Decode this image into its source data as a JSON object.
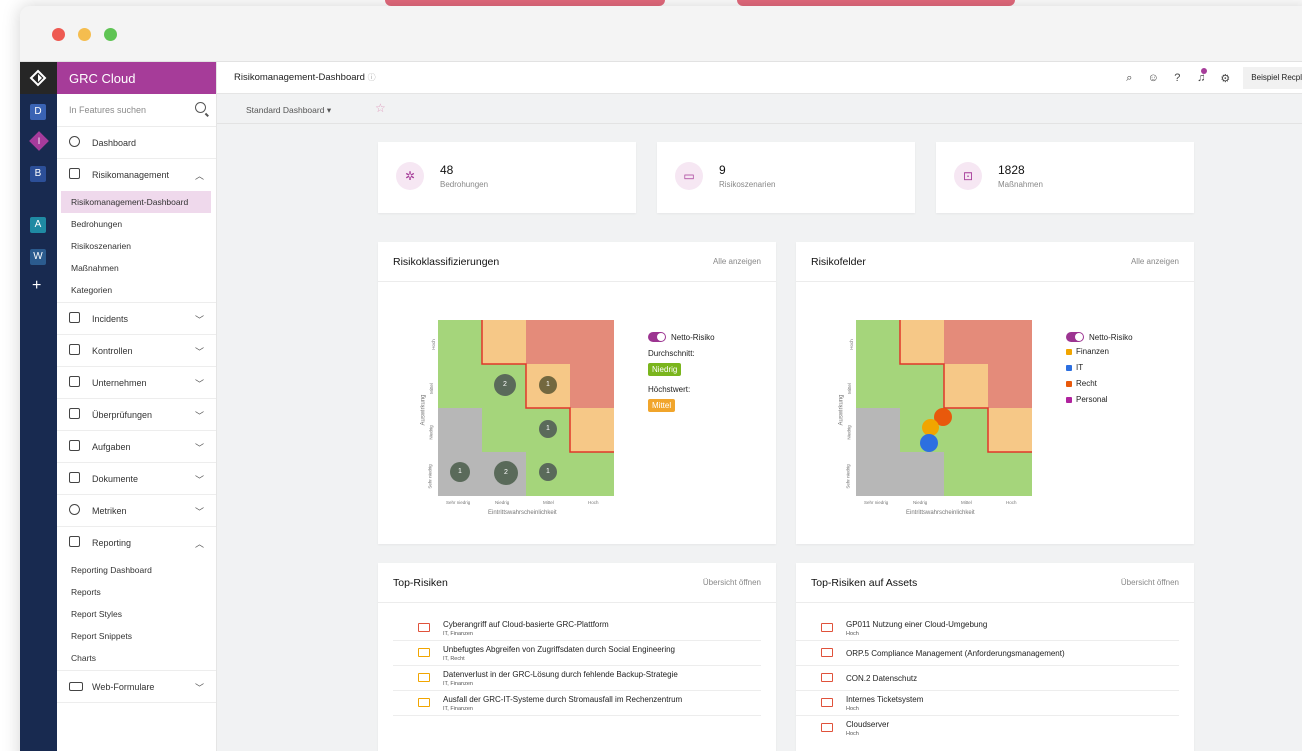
{
  "sidebar": {
    "brand": "GRC Cloud",
    "search_placeholder": "In Features suchen",
    "rail": [
      "D",
      "I",
      "B",
      "A",
      "W",
      "+"
    ],
    "items": [
      {
        "label": "Dashboard",
        "icon": "gauge-icon"
      },
      {
        "label": "Risikomanagement",
        "icon": "alert-icon",
        "expanded": true
      }
    ],
    "risk_sub": [
      "Risikomanagement-Dashboard",
      "Bedrohungen",
      "Risikoszenarien",
      "Maßnahmen",
      "Kategorien"
    ],
    "groups": [
      {
        "label": "Incidents",
        "icon": "incident-icon"
      },
      {
        "label": "Kontrollen",
        "icon": "clipboard-icon"
      },
      {
        "label": "Unternehmen",
        "icon": "building-icon"
      },
      {
        "label": "Überprüfungen",
        "icon": "calendar-check-icon"
      },
      {
        "label": "Aufgaben",
        "icon": "task-icon"
      },
      {
        "label": "Dokumente",
        "icon": "document-icon"
      },
      {
        "label": "Metriken",
        "icon": "gauge-icon"
      },
      {
        "label": "Reporting",
        "icon": "report-icon"
      }
    ],
    "report_sub": [
      "Reporting Dashboard",
      "Reports",
      "Report Styles",
      "Report Snippets",
      "Charts"
    ],
    "web_forms": "Web-Formulare"
  },
  "topbar": {
    "title": "Risikomanagement-Dashboard",
    "user": "Beispiel Recpl",
    "dashboard_select": "Standard Dashboard"
  },
  "stats": [
    {
      "value": "48",
      "label": "Bedrohungen",
      "icon": "threat-icon"
    },
    {
      "value": "9",
      "label": "Risikoszenarien",
      "icon": "scenario-icon"
    },
    {
      "value": "1828",
      "label": "Maßnahmen",
      "icon": "lock-icon"
    }
  ],
  "classification": {
    "title": "Risikoklassifizierungen",
    "link": "Alle anzeigen",
    "toggle_label": "Netto-Risiko",
    "avg_label": "Durchschnitt:",
    "avg_value": "Niedrig",
    "max_label": "Höchstwert:",
    "max_value": "Mittel",
    "y_label": "Auswirkung",
    "x_label": "Eintrittswahrscheinlichkeit",
    "x_ticks": [
      "Sehr niedrig",
      "Niedrig",
      "Mittel",
      "Hoch"
    ],
    "y_ticks": [
      "Hoch",
      "Mittel",
      "Niedrig",
      "Sehr niedrig"
    ],
    "bubbles": [
      "2",
      "1",
      "1",
      "1",
      "2",
      "1"
    ]
  },
  "fields": {
    "title": "Risikofelder",
    "link": "Alle anzeigen",
    "toggle_label": "Netto-Risiko",
    "y_label": "Auswirkung",
    "x_label": "Eintrittswahrscheinlichkeit",
    "x_ticks": [
      "Sehr niedrig",
      "Niedrig",
      "Mittel",
      "Hoch"
    ],
    "y_ticks": [
      "Hoch",
      "Mittel",
      "Niedrig",
      "Sehr niedrig"
    ],
    "legend": [
      {
        "label": "Finanzen",
        "color": "#f1a500"
      },
      {
        "label": "IT",
        "color": "#2c6fe0"
      },
      {
        "label": "Recht",
        "color": "#e8590c"
      },
      {
        "label": "Personal",
        "color": "#b0229e"
      }
    ]
  },
  "top_risks": {
    "title": "Top-Risiken",
    "link": "Übersicht öffnen",
    "rows": [
      {
        "title": "Cyberangriff auf Cloud-basierte GRC-Plattform",
        "sub": "IT, Finanzen",
        "color": "#e0523b"
      },
      {
        "title": "Unbefugtes Abgreifen von Zugriffsdaten durch Social Engineering",
        "sub": "IT, Recht",
        "color": "#f1a500"
      },
      {
        "title": "Datenverlust in der GRC-Lösung durch fehlende Backup-Strategie",
        "sub": "IT, Finanzen",
        "color": "#f1a500"
      },
      {
        "title": "Ausfall der GRC-IT-Systeme durch Stromausfall im Rechenzentrum",
        "sub": "IT, Finanzen",
        "color": "#f1a500"
      }
    ]
  },
  "top_assets": {
    "title": "Top-Risiken auf Assets",
    "link": "Übersicht öffnen",
    "rows": [
      {
        "title": "GP011 Nutzung einer Cloud-Umgebung",
        "sub": "Hoch"
      },
      {
        "title": "ORP.5 Compliance Management (Anforderungsmanagement)",
        "sub": ""
      },
      {
        "title": "CON.2 Datenschutz",
        "sub": ""
      },
      {
        "title": "Internes Ticketsystem",
        "sub": "Hoch"
      },
      {
        "title": "Cloudserver",
        "sub": "Hoch"
      }
    ]
  }
}
